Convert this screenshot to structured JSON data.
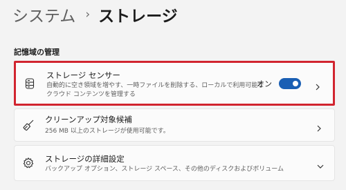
{
  "breadcrumb": {
    "parent": "システム",
    "separator": "›",
    "current": "ストレージ"
  },
  "section": {
    "header": "記憶域の管理"
  },
  "cards": [
    {
      "title": "ストレージ センサー",
      "description": "自動的に空き領域を増やす、一時ファイルを削除する、ローカルで利用可能なクラウド コンテンツを管理する",
      "icon": "storage-drive-icon",
      "toggle_label": "オン",
      "toggle_state": true
    },
    {
      "title": "クリーンアップ対象候補",
      "description": "256 MB 以上のストレージが使用可能です。",
      "icon": "broom-icon"
    },
    {
      "title": "ストレージの詳細設定",
      "description": "バックアップ オプション、ストレージ スペース、その他のディスクおよびボリューム",
      "icon": "gear-icon"
    }
  ],
  "colors": {
    "accent": "#1a5fb4",
    "highlight_border": "#d1242f",
    "background": "#f3f3f3",
    "card_background": "#fbfbfb"
  }
}
